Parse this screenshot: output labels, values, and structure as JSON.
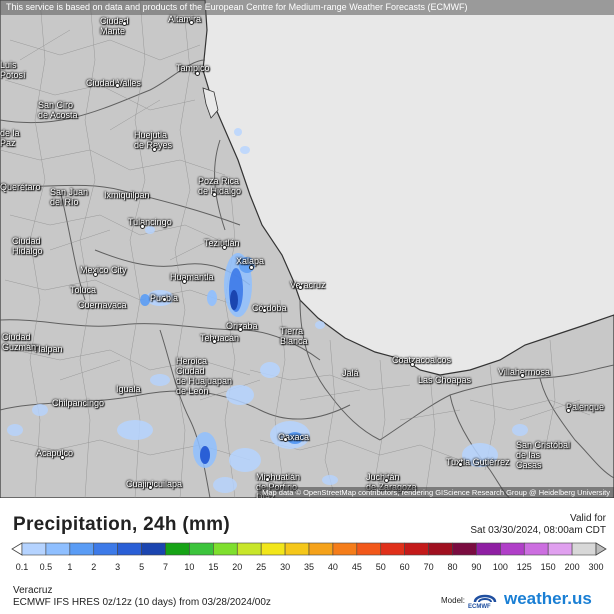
{
  "map": {
    "banner": "This service is based on data and products of the European Centre for Medium-range Weather Forecasts (ECMWF)",
    "attribution": "Map data © OpenStreetMap contributors, rendering GIScience Research Group @ Heidelberg University",
    "cities": [
      {
        "label": "Ciudad\nMante"
      },
      {
        "label": "Altamira"
      },
      {
        "label": "Tampico"
      },
      {
        "label": "Luis\nPotosí"
      },
      {
        "label": "Ciudad Valles"
      },
      {
        "label": "San Ciro\nde Acosta"
      },
      {
        "label": "de la\nPaz"
      },
      {
        "label": "Huejutla\nde Reyes"
      },
      {
        "label": "Querétaro"
      },
      {
        "label": "San Juan\ndel Río"
      },
      {
        "label": "Ixmiquilpan"
      },
      {
        "label": "Poza Rica\nde Hidalgo"
      },
      {
        "label": "Tulancingo"
      },
      {
        "label": "Teziutlán"
      },
      {
        "label": "Ciudad\nHidalgo"
      },
      {
        "label": "Xalapa"
      },
      {
        "label": "Mexico City"
      },
      {
        "label": "Veracruz"
      },
      {
        "label": "Huamantla"
      },
      {
        "label": "Toluca"
      },
      {
        "label": "Puebla"
      },
      {
        "label": "Cuernavaca"
      },
      {
        "label": "Córdoba"
      },
      {
        "label": "Orizaba"
      },
      {
        "label": "Tehuacán"
      },
      {
        "label": "Tierra\nBlanca"
      },
      {
        "label": "Heroica\nCiudad\nde Huajuapan\nde León"
      },
      {
        "label": "Tlalpan"
      },
      {
        "label": "Ciudad\nGuzmán"
      },
      {
        "label": "Coatzacoalcos"
      },
      {
        "label": "Las Choapas"
      },
      {
        "label": "Villahermosa"
      },
      {
        "label": "Iguala"
      },
      {
        "label": "Jalá"
      },
      {
        "label": "Chilpancingo"
      },
      {
        "label": "Palenque"
      },
      {
        "label": "Oaxaca"
      },
      {
        "label": "Acapulco"
      },
      {
        "label": "San Cristóbal\nde las\nCasas"
      },
      {
        "label": "Tuxtla Gutiérrez"
      },
      {
        "label": "Miahuatlán\nde Porfirio\nDíaz"
      },
      {
        "label": "Juchitán\nde Zaragoza"
      },
      {
        "label": "Cuajinicuilapa"
      }
    ]
  },
  "header": {
    "title": "Precipitation, 24h (mm)",
    "valid_label": "Valid for",
    "valid_time": "Sat 03/30/2024, 08:00am CDT"
  },
  "legend": {
    "levels": [
      "0.1",
      "0.5",
      "1",
      "2",
      "3",
      "5",
      "7",
      "10",
      "15",
      "20",
      "25",
      "30",
      "35",
      "40",
      "45",
      "50",
      "60",
      "70",
      "80",
      "90",
      "100",
      "125",
      "150",
      "200",
      "300"
    ],
    "colors": [
      "#b5d3ff",
      "#8fbfff",
      "#5a9cf5",
      "#3d7ae8",
      "#2a5fd6",
      "#1b45b0",
      "#16a316",
      "#3cc43c",
      "#7fdf2e",
      "#c8e62a",
      "#f2e61a",
      "#f5c71a",
      "#f5a21a",
      "#f57d1a",
      "#f2581a",
      "#e0301a",
      "#c41a1a",
      "#a01020",
      "#7a0c40",
      "#8f1fa3",
      "#b03fc8",
      "#cc6ee0",
      "#e0a0ef",
      "#d8d8d8"
    ]
  },
  "footer": {
    "location": "Veracruz",
    "model": "ECMWF IFS HRES 0z/12z (10 days) from 03/28/2024/00z",
    "model_tag": "Model:",
    "ecmwf": "ECMWF",
    "brand": "weather.us"
  }
}
